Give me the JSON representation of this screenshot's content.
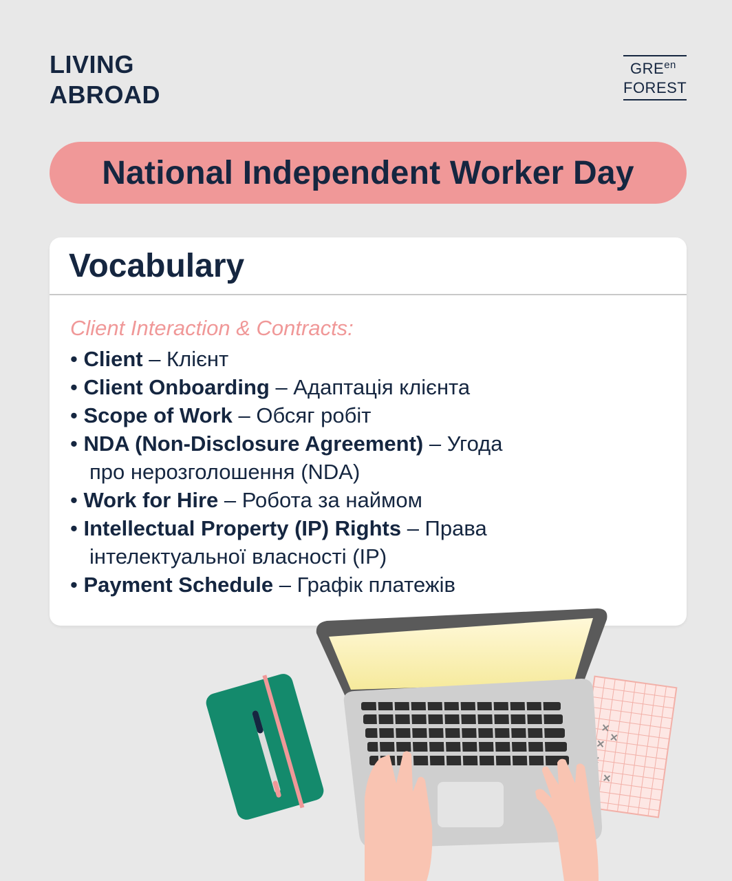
{
  "brand": {
    "line1": "LIVING",
    "line2": "ABROAD"
  },
  "logo": {
    "part1": "GRE",
    "part1_sup": "en",
    "part2": "FOREST"
  },
  "title": "National Independent Worker Day",
  "card": {
    "heading": "Vocabulary",
    "section_title": "Client Interaction & Contracts:",
    "items": [
      {
        "bullet": "• ",
        "term": "Client",
        "translation": " – Клієнт",
        "translation_cont": ""
      },
      {
        "bullet": "• ",
        "term": "Client Onboarding",
        "translation": " – Адаптація клієнта",
        "translation_cont": ""
      },
      {
        "bullet": "• ",
        "term": "Scope of Work",
        "translation": " – Обсяг робіт",
        "translation_cont": ""
      },
      {
        "bullet": "• ",
        "term": "NDA (Non-Disclosure Agreement)",
        "translation": " – Угода",
        "translation_cont": "про нерозголошення (NDA)"
      },
      {
        "bullet": "• ",
        "term": "Work for Hire",
        "translation": " – Робота за наймом",
        "translation_cont": ""
      },
      {
        "bullet": "• ",
        "term": "Intellectual Property (IP) Rights",
        "translation": " – Права",
        "translation_cont": "інтелектуальної власності (IP)"
      },
      {
        "bullet": "• ",
        "term": "Payment Schedule",
        "translation": " – Графік платежів",
        "translation_cont": ""
      }
    ]
  },
  "colors": {
    "navy": "#152640",
    "pink": "#f09898",
    "green": "#148a6c",
    "background": "#e8e8e8"
  }
}
